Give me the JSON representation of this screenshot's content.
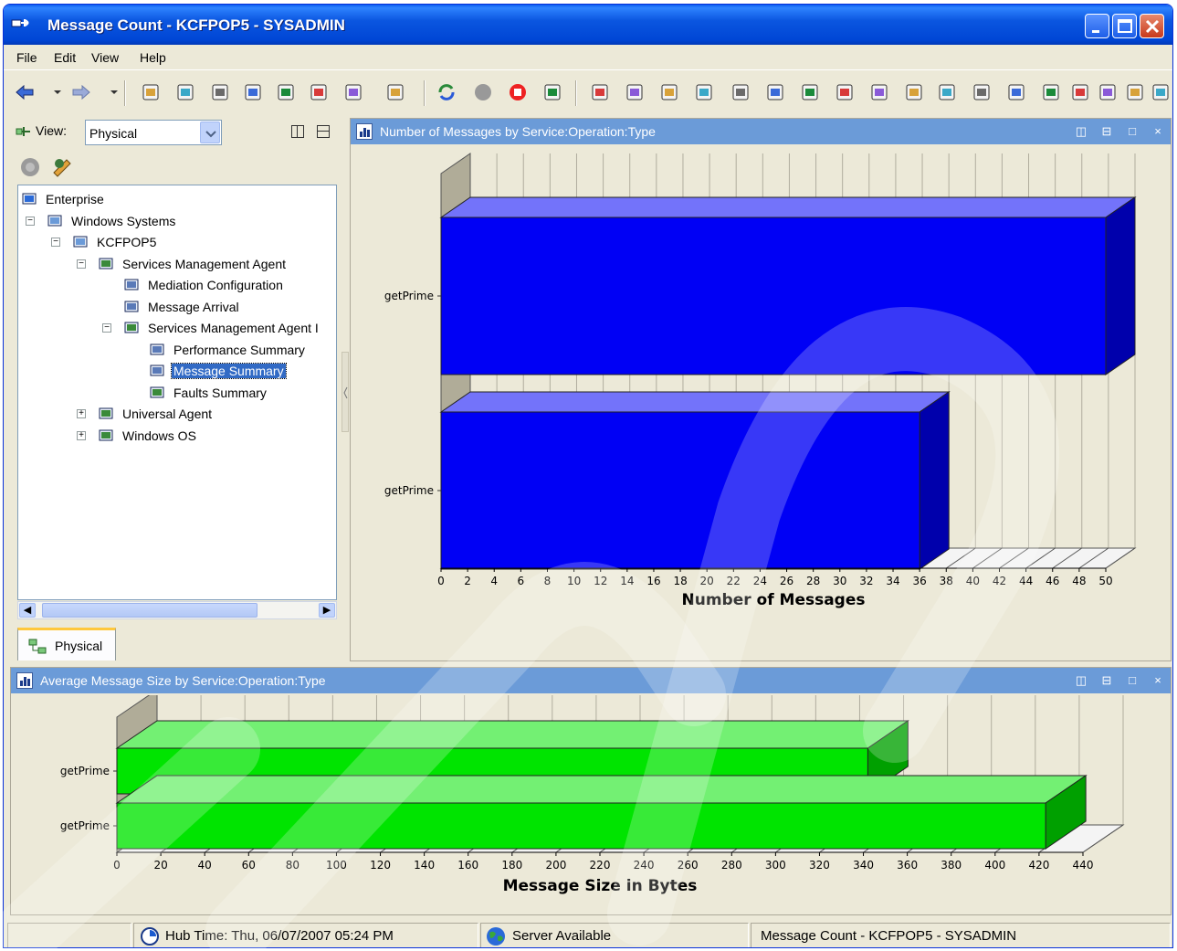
{
  "window": {
    "title": "Message Count - KCFPOP5 - SYSADMIN"
  },
  "menu": [
    "File",
    "Edit",
    "View",
    "Help"
  ],
  "toolbar_icons": [
    "back-icon",
    "back-dropdown-icon",
    "forward-icon",
    "forward-dropdown-icon",
    "new-workspace-icon",
    "save-icon",
    "properties-icon",
    "history-icon",
    "link-icon",
    "navigator-icon",
    "find-icon",
    "help-icon",
    "refresh-icon",
    "pause-icon",
    "stop-icon",
    "sound-icon",
    "plot-chart-icon",
    "table-icon",
    "pie-chart-icon",
    "bar-chart-icon",
    "line-chart-icon",
    "gauge-icon",
    "circular-gauge-icon",
    "notepad-icon",
    "event-console-icon",
    "message-log-icon",
    "terminal-icon",
    "take-action-icon",
    "browser-icon",
    "graphic-view-icon",
    "edge-icon",
    "topology-icon",
    "situation-icon",
    "tree-icon"
  ],
  "nav": {
    "view_label": "View:",
    "view_value": "Physical",
    "tab_label": "Physical",
    "tree": [
      {
        "label": "Enterprise",
        "level": 0,
        "icon": "enterprise-icon"
      },
      {
        "label": "Windows Systems",
        "level": 1,
        "icon": "systems-icon",
        "expander": "−"
      },
      {
        "label": "KCFPOP5",
        "level": 2,
        "icon": "host-icon",
        "expander": "−"
      },
      {
        "label": "Services Management Agent",
        "level": 3,
        "icon": "agent-icon",
        "expander": "−"
      },
      {
        "label": "Mediation Configuration",
        "level": 4,
        "icon": "workspace-icon"
      },
      {
        "label": "Message Arrival",
        "level": 4,
        "icon": "workspace-icon"
      },
      {
        "label": "Services Management Agent I",
        "level": 4,
        "icon": "agent-icon",
        "expander": "−",
        "exp_level": 4
      },
      {
        "label": "Performance Summary",
        "level": 5,
        "icon": "workspace-icon"
      },
      {
        "label": "Message Summary",
        "level": 5,
        "icon": "workspace-icon",
        "selected": true
      },
      {
        "label": "Faults Summary",
        "level": 5,
        "icon": "faults-icon"
      },
      {
        "label": "Universal Agent",
        "level": 3,
        "icon": "agent-icon",
        "expander": "+"
      },
      {
        "label": "Windows OS",
        "level": 3,
        "icon": "agent-icon",
        "expander": "+"
      }
    ]
  },
  "panels": {
    "top": {
      "title": "Number of Messages by Service:Operation:Type"
    },
    "bottom": {
      "title": "Average Message Size by Service:Operation:Type"
    }
  },
  "chart_data": [
    {
      "type": "bar",
      "orientation": "horizontal",
      "style": "3d",
      "categories": [
        "getPrime",
        "getPrime"
      ],
      "values": [
        50,
        36
      ],
      "xlabel": "Number of Messages",
      "xlim": [
        0,
        50
      ],
      "xticks": [
        0,
        2,
        4,
        6,
        8,
        10,
        12,
        14,
        16,
        18,
        20,
        22,
        24,
        26,
        28,
        30,
        32,
        34,
        36,
        38,
        40,
        42,
        44,
        46,
        48,
        50
      ],
      "color": "#0000f5",
      "grid": true
    },
    {
      "type": "bar",
      "orientation": "horizontal",
      "style": "3d",
      "categories": [
        "getPrime",
        "getPrime"
      ],
      "values": [
        342,
        423
      ],
      "xlabel": "Message Size in Bytes",
      "xlim": [
        0,
        440
      ],
      "xticks": [
        0,
        20,
        40,
        60,
        80,
        100,
        120,
        140,
        160,
        180,
        200,
        220,
        240,
        260,
        280,
        300,
        320,
        340,
        360,
        380,
        400,
        420,
        440
      ],
      "color": "#00e400",
      "grid": true
    }
  ],
  "status": {
    "hub_time": "Hub Time: Thu, 06/07/2007 05:24 PM",
    "server": "Server Available",
    "workspace": "Message Count - KCFPOP5 - SYSADMIN"
  },
  "colors": {
    "title_bar": "#0046d5",
    "panel_header": "#6b9bd8",
    "selection": "#316ac5"
  }
}
